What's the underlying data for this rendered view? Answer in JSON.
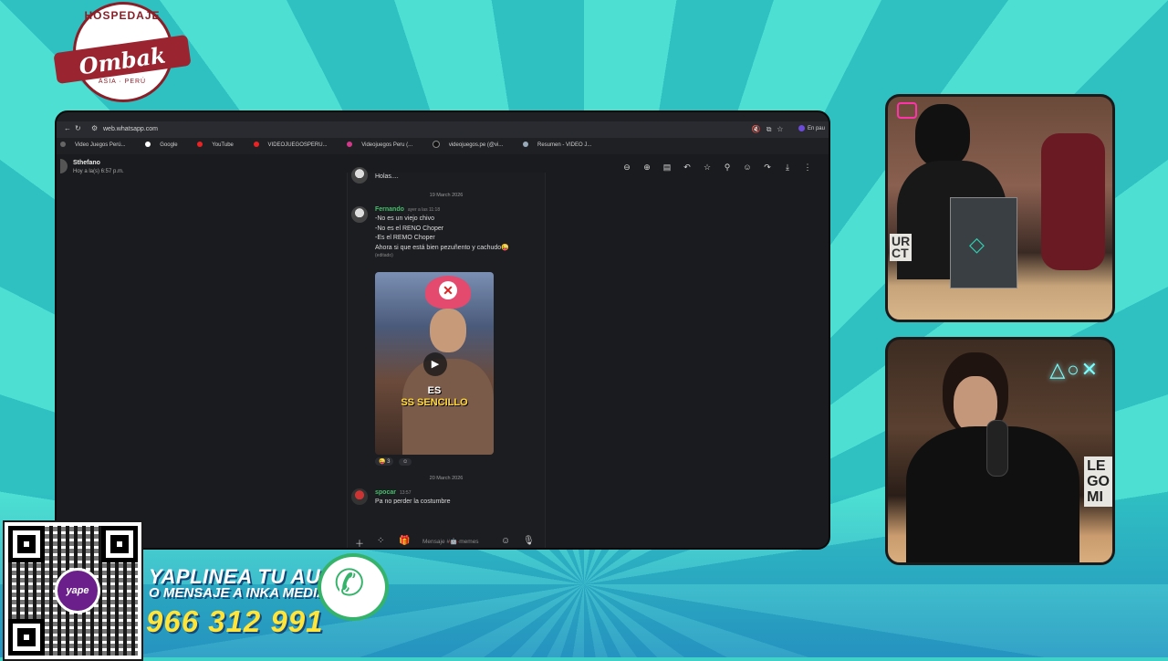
{
  "logo": {
    "top_text": "HOSPEDAJE",
    "name": "Ombak",
    "sub_text": "ASIA · PERÚ"
  },
  "browser": {
    "url": "web.whatsapp.com",
    "pause_label": "En pau",
    "bookmarks": [
      "Video Juegos Perú...",
      "Google",
      "YouTube",
      "VIDEOJUEGOSPERU...",
      "Videojuegos Peru (...",
      "videojuegos.pe (@vi...",
      "Resumen - VIDEO J..."
    ]
  },
  "chat": {
    "contact_name": "Sthefano",
    "contact_status": "Hoy a la(s) 6:57 p.m.",
    "first_message": "Holas....",
    "date1": "19 March 2026",
    "msg2": {
      "author": "Fernando",
      "meta": "ayer a las 11:18",
      "lines": [
        "-No es un viejo chivo",
        "-No es el RENO Choper",
        "-Es el REMO Choper",
        "Ahora si que está bien pezuñento y cachudo😜"
      ],
      "edited": "(editado)"
    },
    "video_caption_1": "ES",
    "video_caption_2": "SS SENCILLO",
    "reaction_count": "3",
    "date2": "20 March 2026",
    "msg3": {
      "author": "spocar",
      "meta": "13:57",
      "text": "Pa no perder la costumbre"
    },
    "composer_placeholder": "Mensaje #🤖·memes"
  },
  "promo": {
    "line1": "YAPLINEA TU AUDIO",
    "line2": "O MENSAJE A INKA MEDIA",
    "phone": "966 312 991",
    "yape_label": "yape"
  },
  "webcam": {
    "sign1": "UR\nCT",
    "sign2": "LE\nGO\nMI",
    "ps_symbols": "△○✕"
  }
}
